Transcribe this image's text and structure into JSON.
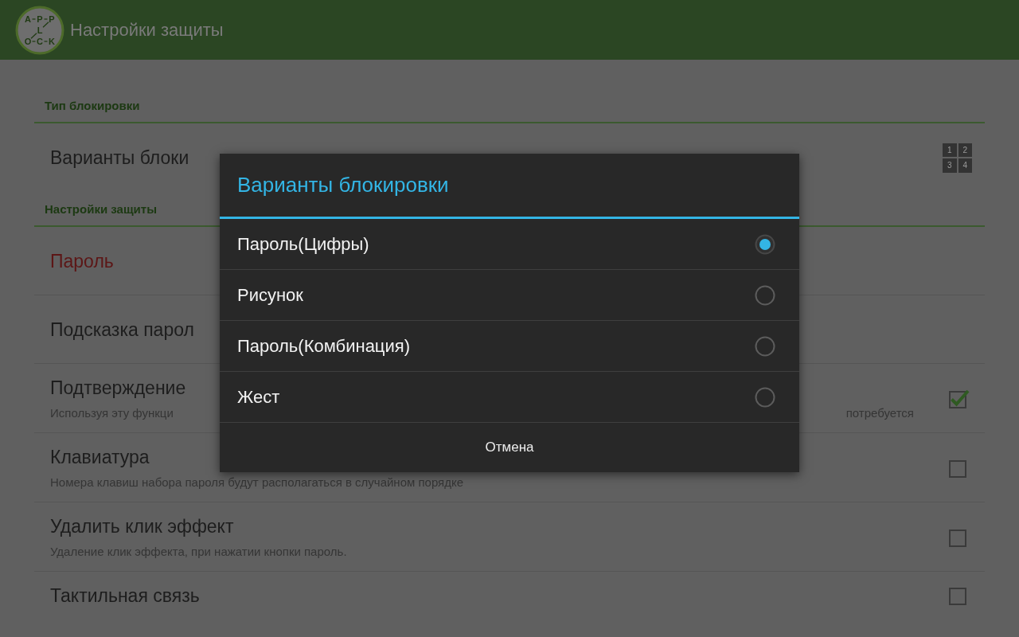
{
  "app_bar": {
    "logo": {
      "rows": [
        [
          "A",
          "P",
          "P"
        ],
        [
          "",
          "L",
          ""
        ],
        [
          "O",
          "C",
          "K"
        ]
      ]
    },
    "title": "Настройки защиты"
  },
  "sections": [
    {
      "title": "Тип блокировки",
      "items": [
        {
          "kind": "keypad",
          "title": "Варианты блоки",
          "keys": [
            "1",
            "2",
            "3",
            "4"
          ]
        }
      ]
    },
    {
      "title": "Настройки защиты",
      "items": [
        {
          "kind": "alert",
          "title": "Пароль"
        },
        {
          "kind": "plain",
          "title": "Подсказка парол"
        },
        {
          "kind": "checkbox",
          "title": "Подтверждение",
          "summary": "Используя эту функци",
          "summary_tail": "потребуется",
          "checked": true
        },
        {
          "kind": "checkbox",
          "title": "Клавиатура",
          "summary": "Номера клавиш набора пароля будут располагаться в случайном порядке",
          "checked": false
        },
        {
          "kind": "checkbox",
          "title": "Удалить клик эффект",
          "summary": "Удаление клик эффекта, при нажатии кнопки пароль.",
          "checked": false
        },
        {
          "kind": "checkbox",
          "title": "Тактильная связь",
          "checked": false
        }
      ]
    }
  ],
  "dialog": {
    "title": "Варианты блокировки",
    "options": [
      {
        "label": "Пароль(Цифры)",
        "selected": true
      },
      {
        "label": "Рисунок",
        "selected": false
      },
      {
        "label": "Пароль(Комбинация)",
        "selected": false
      },
      {
        "label": "Жест",
        "selected": false
      }
    ],
    "cancel": "Отмена"
  }
}
